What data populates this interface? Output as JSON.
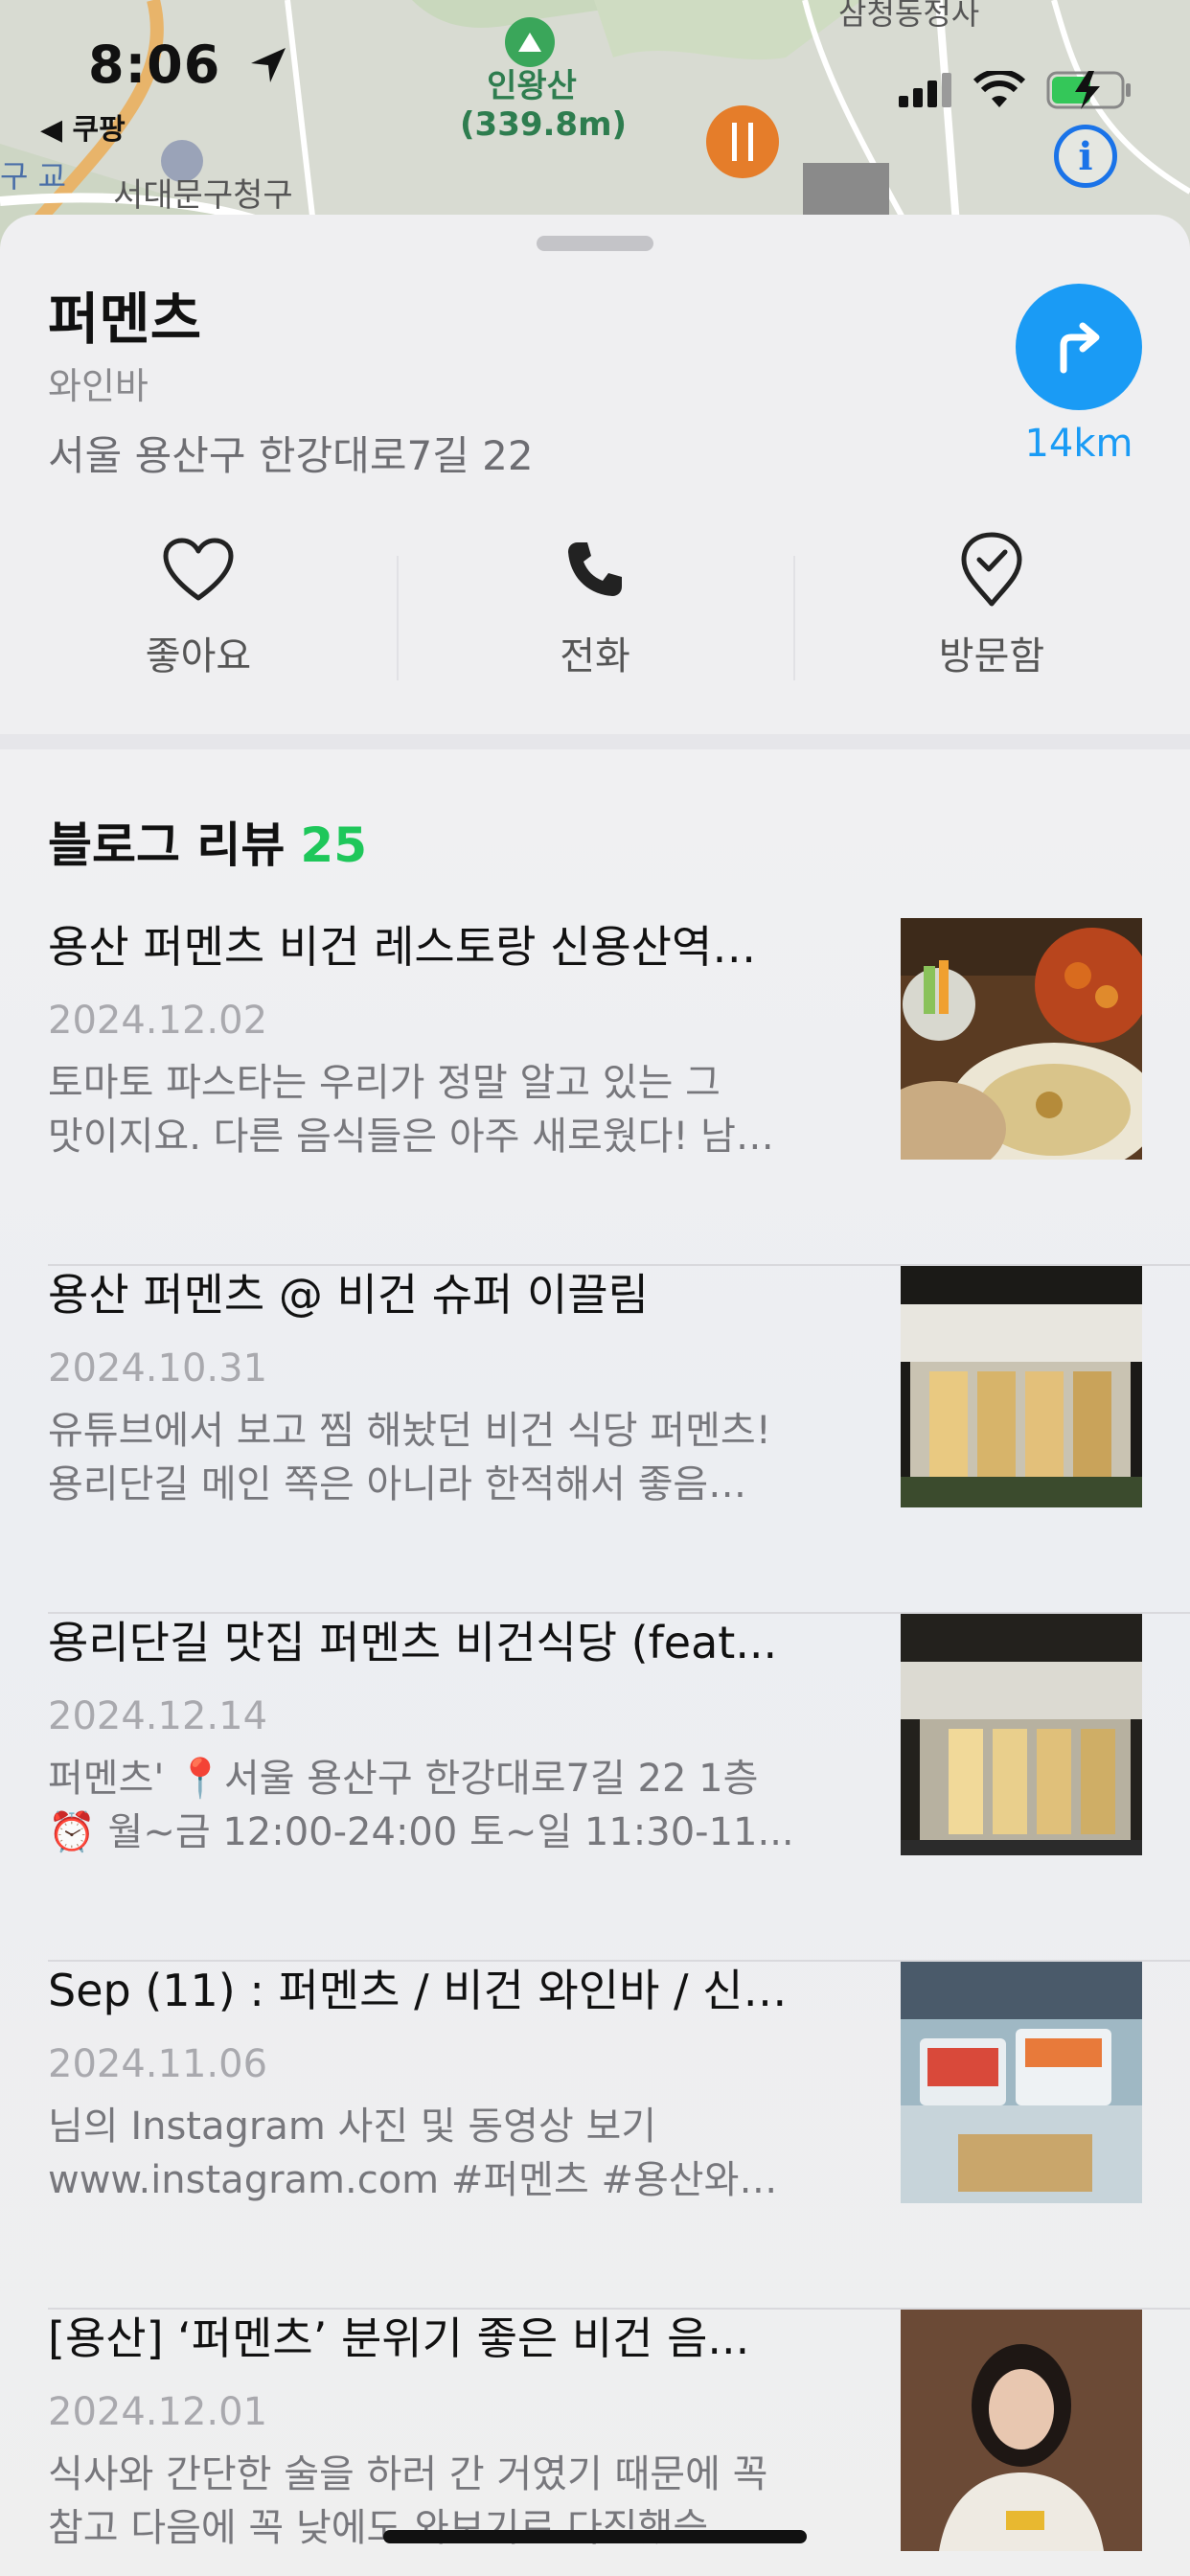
{
  "status_bar": {
    "time": "8:06",
    "back_app": "◀ 쿠팡"
  },
  "map": {
    "poi_mountain_name": "인왕산",
    "poi_mountain_distance": "(339.8m)",
    "top_label": "삼청동정사",
    "district_label": "서대문구청구",
    "left_label": "구 교"
  },
  "place": {
    "name": "퍼멘츠",
    "category": "와인바",
    "address": "서울 용산구 한강대로7길 22",
    "distance": "14km"
  },
  "actions": [
    {
      "label": "좋아요",
      "icon": "heart-icon"
    },
    {
      "label": "전화",
      "icon": "phone-icon"
    },
    {
      "label": "방문함",
      "icon": "visited-pin-icon"
    }
  ],
  "reviews": {
    "title": "블로그 리뷰",
    "count": "25",
    "items": [
      {
        "title": "용산 퍼멘츠 비건 레스토랑 신용산역…",
        "date": "2024.12.02",
        "line1": "토마토 파스타는 우리가 정말 알고 있는 그",
        "line2": "맛이지요. 다른 음식들은 아주 새로웠다! 남…"
      },
      {
        "title": "용산 퍼멘츠 @ 비건 슈퍼 이끌림",
        "date": "2024.10.31",
        "line1": "유튜브에서 보고 찜 해놨던 비건 식당 퍼멘츠!",
        "line2": "용리단길 메인 쪽은 아니라 한적해서 좋음…"
      },
      {
        "title": "용리단길 맛집 퍼멘츠 비건식당 (feat...",
        "date": "2024.12.14",
        "line1": "퍼멘츠'   📍서울 용산구 한강대로7길 22 1층",
        "line2": "⏰ 월~금 12:00-24:00 토~일 11:30-11..."
      },
      {
        "title": "Sep (11) : 퍼멘츠 / 비건 와인바 / 신…",
        "date": "2024.11.06",
        "line1": "님의 Instagram 사진 및 동영상 보기",
        "line2": "www.instagram.com   #퍼멘츠 #용산와…"
      },
      {
        "title": "[용산] ‘퍼멘츠’ 분위기 좋은 비건 음...",
        "date": "2024.12.01",
        "line1": "식사와 간단한 술을 하러 간 거였기 때문에 꼭",
        "line2": "참고 다음에 꼭 낮에도 와보기로 다짐했습"
      }
    ]
  },
  "colors": {
    "accent_blue": "#1a9bf5",
    "count_green": "#1ec75a"
  }
}
